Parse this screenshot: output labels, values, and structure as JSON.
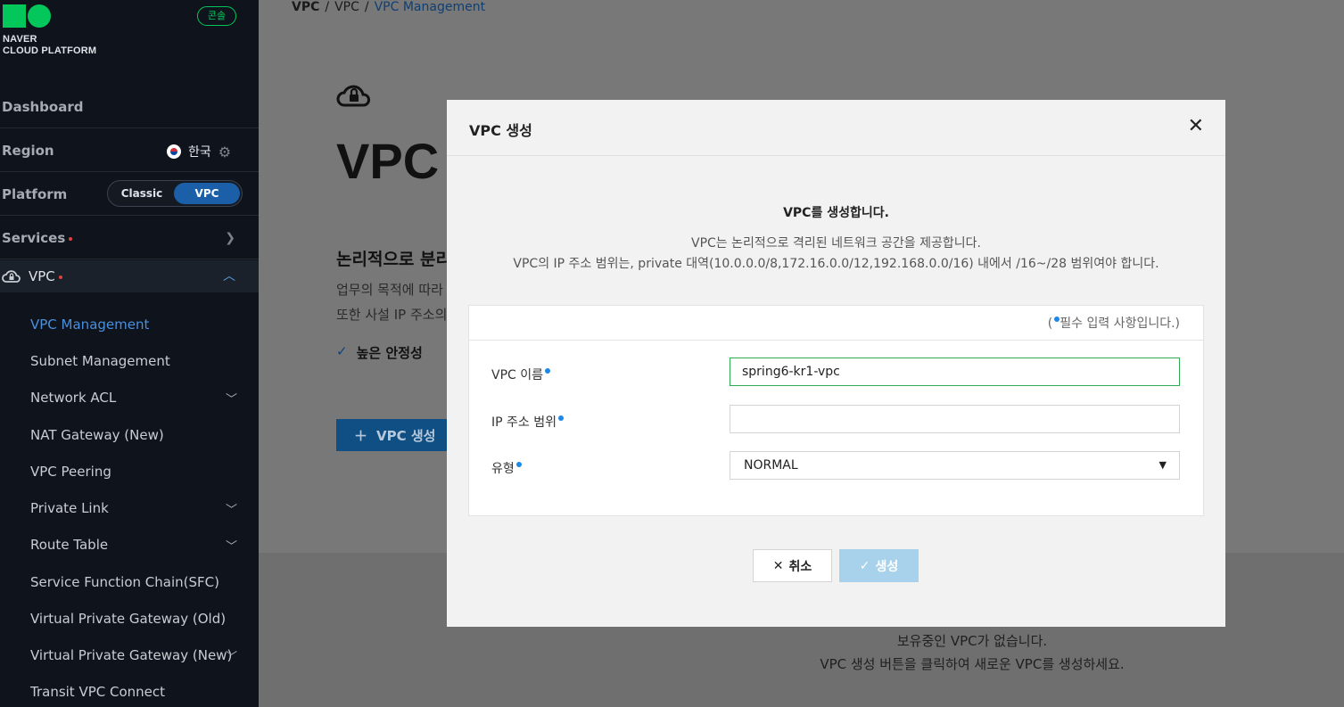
{
  "sidebar": {
    "logo_line1": "NAVER",
    "logo_line2": "CLOUD PLATFORM",
    "console_badge": "콘솔",
    "dashboard": "Dashboard",
    "region_label": "Region",
    "region_value": "한국",
    "platform_label": "Platform",
    "platform_classic": "Classic",
    "platform_vpc": "VPC",
    "services": "Services",
    "vpc_section": "VPC",
    "items": [
      {
        "label": "VPC Management"
      },
      {
        "label": "Subnet Management"
      },
      {
        "label": "Network ACL"
      },
      {
        "label": "NAT Gateway (New)"
      },
      {
        "label": "VPC Peering"
      },
      {
        "label": "Private Link"
      },
      {
        "label": "Route Table"
      },
      {
        "label": "Service Function Chain(SFC)"
      },
      {
        "label": "Virtual Private Gateway (Old)"
      },
      {
        "label": "Virtual Private Gateway (New)"
      },
      {
        "label": "Transit VPC Connect"
      }
    ]
  },
  "breadcrumb": {
    "b1": "VPC",
    "sep": "/",
    "b2": "VPC",
    "b3": "VPC Management"
  },
  "page": {
    "title": "VPC",
    "desc_heading": "논리적으로 분리",
    "desc_p1": "업무의 목적에 따라",
    "desc_p2": "또한 사설 IP 주소의",
    "check_item": "높은 안정성",
    "create_button": "VPC 생성",
    "empty_line1": "보유중인 VPC가 없습니다.",
    "empty_line2": "VPC 생성 버튼을 클릭하여 새로운 VPC를 생성하세요."
  },
  "modal": {
    "title": "VPC 생성",
    "intro_heading": "VPC를 생성합니다.",
    "intro_line1": "VPC는 논리적으로 격리된 네트워크 공간을 제공합니다.",
    "intro_line2": "VPC의 IP 주소 범위는, private 대역(10.0.0.0/8,172.16.0.0/12,192.168.0.0/16) 내에서 /16~/28 범위여야 합니다.",
    "required_note_pre": "(",
    "required_note": "필수 입력 사항입니다.)",
    "fields": {
      "vpc_name_label": "VPC 이름",
      "vpc_name_value": "spring6-kr1-vpc",
      "ip_range_label": "IP 주소 범위",
      "ip_range_value": "",
      "type_label": "유형",
      "type_value": "NORMAL"
    },
    "cancel_label": "취소",
    "create_label": "생성"
  },
  "colors": {
    "accent": "#1e88e5",
    "brand_green": "#03c75a",
    "create_disabled": "#a8d2ec"
  }
}
